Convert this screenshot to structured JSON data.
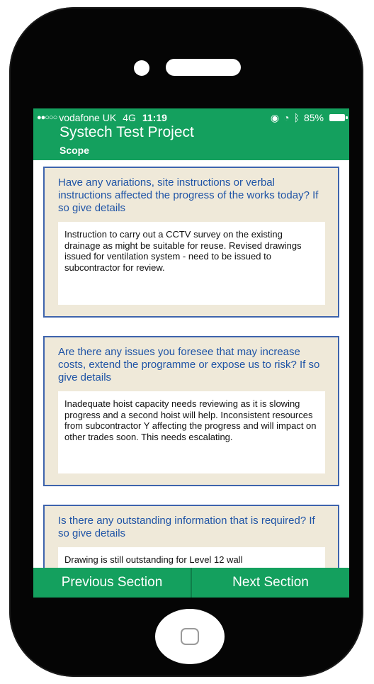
{
  "status_bar": {
    "carrier": "vodafone UK",
    "network": "4G",
    "time": "11:19",
    "battery": "85%"
  },
  "header": {
    "title": "Systech Test Project",
    "subtitle": "Scope"
  },
  "cards": [
    {
      "question": "Have any variations, site instructions or verbal instructions affected the progress of the works today? If so give details",
      "answer": "Instruction to carry out a CCTV survey on the existing drainage as might be suitable for reuse. Revised drawings issued for ventilation system - need to be issued to subcontractor for review."
    },
    {
      "question": "Are there any issues you foresee that may increase costs, extend the programme or expose us to risk? If so give details",
      "answer": "Inadequate hoist capacity needs reviewing as it is slowing progress and a second hoist will help. Inconsistent resources from subcontractor Y affecting the progress and will impact on other trades soon. This needs escalating."
    },
    {
      "question": "Is there any outstanding information that is required? If so give details",
      "answer": "Drawing is still outstanding for Level 12 wall"
    }
  ],
  "footer": {
    "previous_label": "Previous Section",
    "next_label": "Next Section"
  },
  "colors": {
    "header_green": "#14a05e",
    "card_background": "#efe9d9",
    "card_border": "#3e64ad",
    "question_text": "#1f54a6"
  },
  "icons": [
    "signal-dots-icon",
    "location-icon",
    "alarm-icon",
    "bluetooth-icon",
    "battery-icon",
    "home-button-icon"
  ]
}
